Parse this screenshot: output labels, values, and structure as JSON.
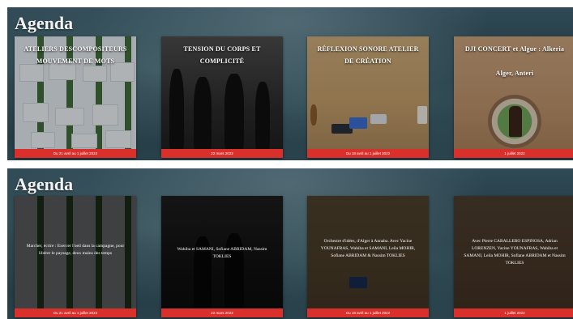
{
  "sections": [
    {
      "title": "Agenda",
      "cards": [
        {
          "title": "ATELIERS DESCOMPOSITEURS MOUVEMENT DE MOTS",
          "date": "Du 21 avril au 1 juillet 2022"
        },
        {
          "title": "TENSION DU CORPS ET COMPLICITÉ",
          "date": "22 mars 2022"
        },
        {
          "title": "RÉFLEXION SONORE ATELIER DE CRÉATION",
          "date": "Du 18 avril au 1 juillet 2022"
        },
        {
          "title": "DJI CONCERT et Algue : Alkeria",
          "subtitle": "Alger, Anteri",
          "date": "1 juillet 2022"
        }
      ]
    },
    {
      "title": "Agenda",
      "cards": [
        {
          "desc": "Marcher, écrire : Exercer l'oeil dans la campagne, pour libérer le paysage, deux mains des temps",
          "date": "Du 21 avril au 1 juillet 2022"
        },
        {
          "desc": "Wahiba et SAMANI, Sofiane ABRIDAM, Nassim TOKLIES",
          "date": "22 mars 2022"
        },
        {
          "desc": "Orchestre d'idées, d'Alger à Annaba. Avec Yacine YOUNAFRAS, Wahiba et SAMANI, Leila MOHIR, Sofiane ABRIDAM & Nassim TOKLIES",
          "date": "Du 18 avril au 1 juillet 2022"
        },
        {
          "desc": "Avec Pierre CABALLERO ESPINOSA, Adrian LORENZEN, Yacine YOUNAFRAS, Wahiba et SAMANI, Leila MOHIR, Sofiane ABRIDAM et Nassim TOKLIES",
          "date": "1 juillet 2022"
        }
      ]
    }
  ]
}
